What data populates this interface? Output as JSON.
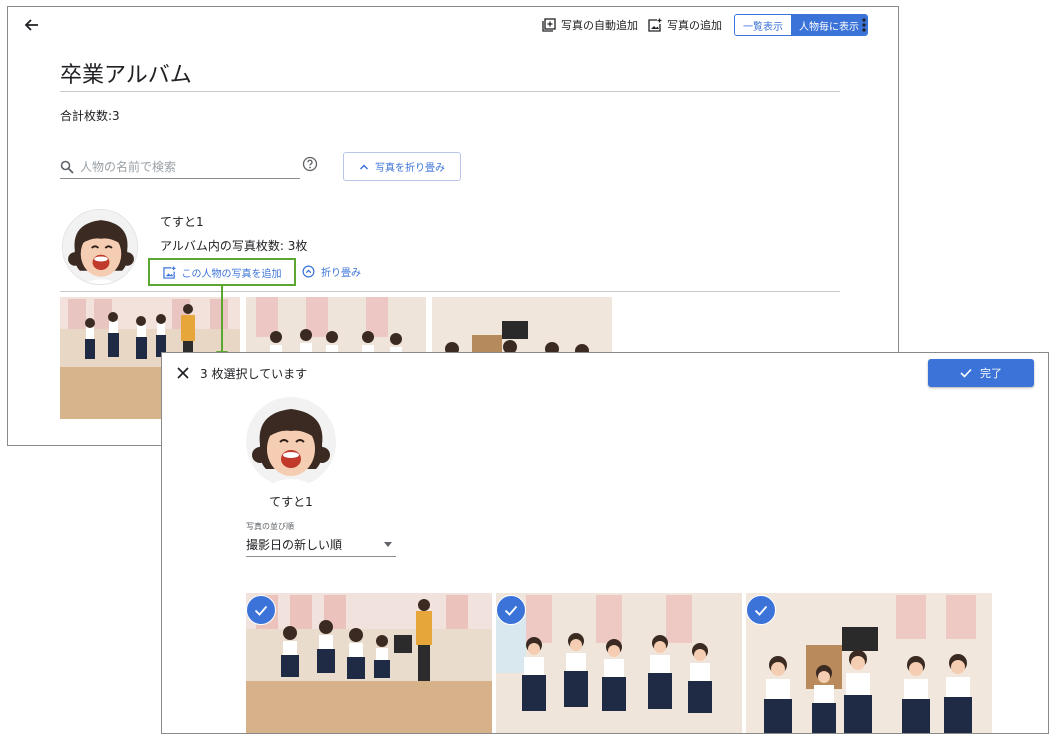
{
  "toolbar": {
    "auto_add_label": "写真の自動追加",
    "add_photo_label": "写真の追加",
    "view_list_label": "一覧表示",
    "view_person_label": "人物毎に表示"
  },
  "album": {
    "title": "卒業アルバム",
    "total_count": "合計枚数:3"
  },
  "search": {
    "placeholder": "人物の名前で検索",
    "collapse_all_label": "写真を折り畳み"
  },
  "person": {
    "name": "てすと1",
    "photo_count": "アルバム内の写真枚数: 3枚",
    "add_photo_label": "この人物の写真を追加",
    "fold_label": "折り畳み"
  },
  "dialog": {
    "selected_text": "3 枚選択しています",
    "done_label": "完了",
    "person_name": "てすと1",
    "sort_label": "写真の並び順",
    "sort_value": "撮影日の新しい順"
  },
  "colors": {
    "accent": "#3b73d9",
    "highlight_border": "#5aa832"
  },
  "icons": [
    "back-arrow-icon",
    "auto-add-icon",
    "add-photo-icon",
    "more-vert-icon",
    "search-icon",
    "help-icon",
    "chevron-up-icon",
    "collapse-circle-icon",
    "close-icon",
    "check-icon",
    "dropdown-arrow-icon"
  ]
}
